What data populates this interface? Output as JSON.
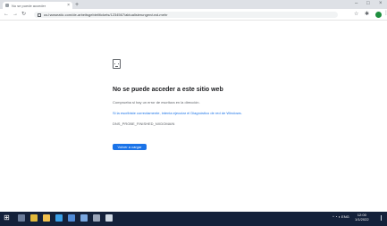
{
  "browser": {
    "tab_title": "No se puede acceder",
    "tab_close": "×",
    "new_tab": "+",
    "window_controls": [
      "–",
      "□",
      "×"
    ],
    "nav": {
      "back": "←",
      "forward": "→",
      "reload": "↻"
    },
    "url": "us.hanseatic.com/de-arbeitsgebiet/tickets/1234567/aktualisierungen/und-mehr",
    "toolbar_icons": {
      "star": "☆",
      "puzzle": "✱"
    },
    "menu": "⋮"
  },
  "error_page": {
    "title": "No se puede acceder a este sitio web",
    "subtitle": "Comprueba si hay un error de escritura en la dirección.",
    "help": "Si la escribiste correctamente, intenta ejecutar el Diagnóstico de red de Windows.",
    "error_code": "DNS_PROBE_FINISHED_NXDOMAIN",
    "reload_button": "Volver a cargar"
  },
  "taskbar": {
    "start": "⊞",
    "apps": [
      {
        "name": "search",
        "color": "#6b7c99"
      },
      {
        "name": "chrome",
        "color": "#e2b93b"
      },
      {
        "name": "explorer",
        "color": "#f2c14e"
      },
      {
        "name": "edge",
        "color": "#3aa0e8"
      },
      {
        "name": "mail",
        "color": "#4f8ad6"
      },
      {
        "name": "store",
        "color": "#7aa7e0"
      },
      {
        "name": "settings",
        "color": "#9aa5b8"
      },
      {
        "name": "active-app",
        "color": "#cfd8e3"
      }
    ],
    "tray_text": "^ ◔ ◖ ENG",
    "time": "12:00",
    "date": "1/1/2022"
  },
  "colors": {
    "link": "#1a73e8",
    "button": "#1a73e8",
    "taskbar": "#14213a"
  }
}
